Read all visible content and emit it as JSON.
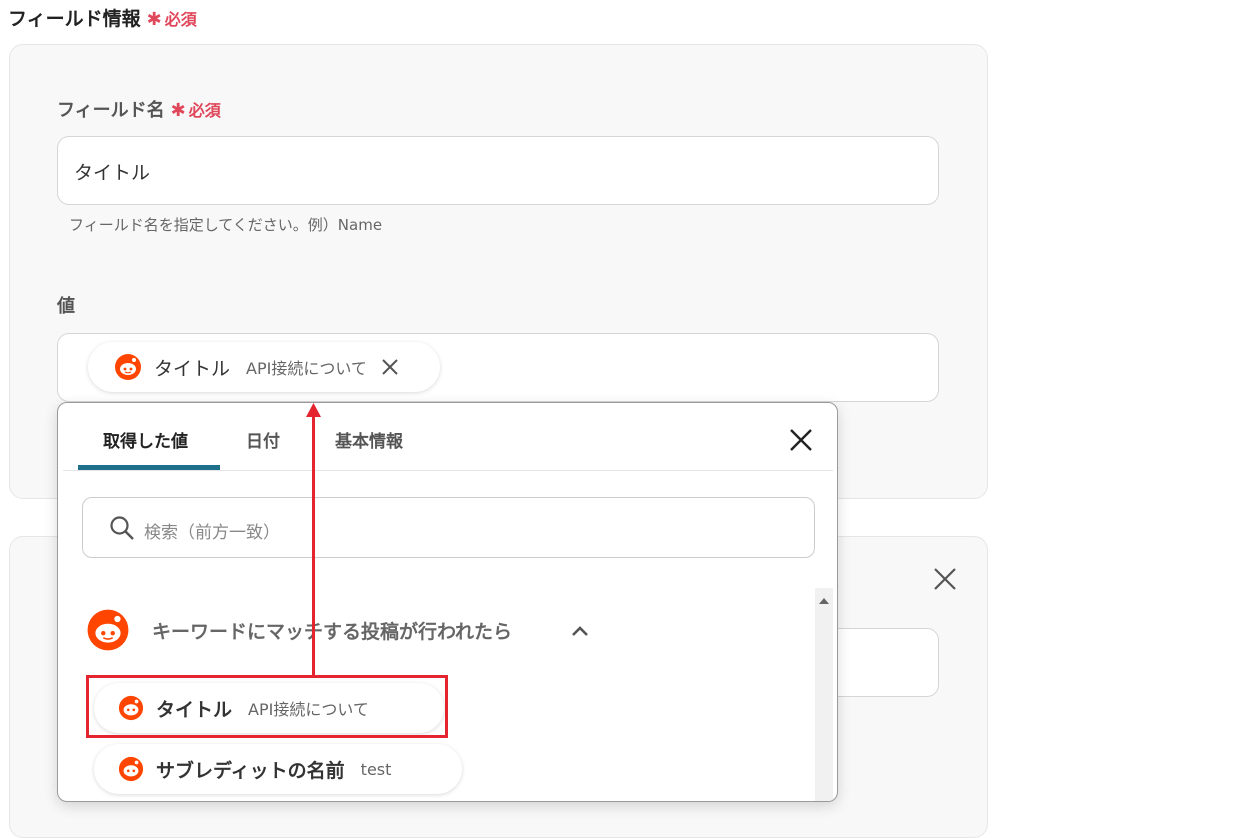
{
  "section": {
    "title": "フィールド情報",
    "required": "必須"
  },
  "field_name": {
    "label": "フィールド名",
    "required": "必須",
    "value": "タイトル",
    "hint": "フィールド名を指定してください。例）Name"
  },
  "value_field": {
    "label": "値",
    "token": {
      "label": "タイトル",
      "sub": "API接続について"
    }
  },
  "picker": {
    "tabs": [
      {
        "label": "取得した値"
      },
      {
        "label": "日付"
      },
      {
        "label": "基本情報"
      }
    ],
    "active_tab": "取得した値",
    "search_placeholder": "検索（前方一致）",
    "group": {
      "title": "キーワードにマッチする投稿が行われたら"
    },
    "items": [
      {
        "label": "タイトル",
        "sub": "API接続について",
        "highlighted": true
      },
      {
        "label": "サブレディットの名前",
        "sub": "test",
        "highlighted": false
      }
    ]
  },
  "colors": {
    "required": "#e0475b",
    "accent_tab": "#1e6f8a",
    "highlight": "#e4242e",
    "reddit": "#ff4500"
  },
  "icons": [
    "reddit-icon",
    "close-icon",
    "search-icon",
    "chevron-up-icon",
    "scroll-up-icon"
  ]
}
